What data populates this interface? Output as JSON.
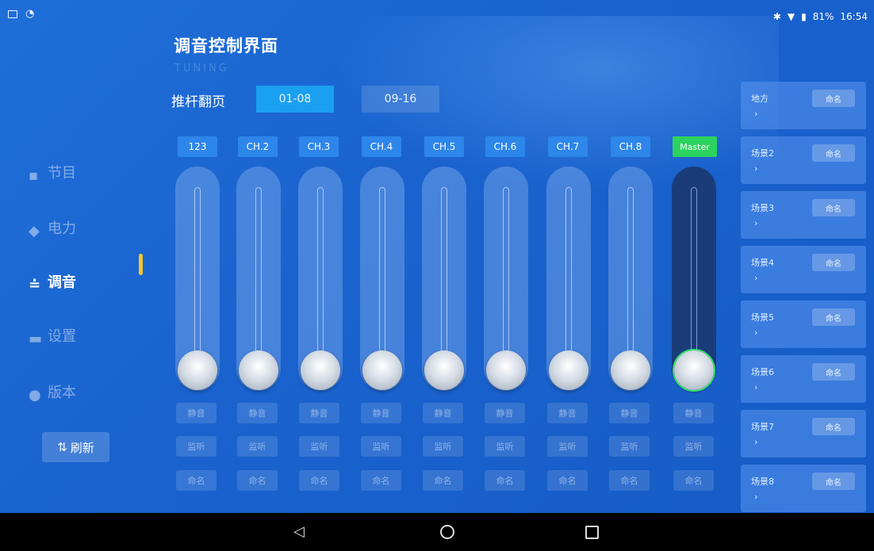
{
  "status_bar": {
    "battery_text": "81%",
    "time": "16:54"
  },
  "header": {
    "title": "调音控制界面",
    "ghost_text": "TUNING"
  },
  "pager": {
    "label": "推杆翻页",
    "tabs": [
      "01-08",
      "09-16"
    ],
    "active_index": 0
  },
  "sidebar": {
    "items": [
      {
        "label": "节目",
        "icon": "program-icon"
      },
      {
        "label": "电力",
        "icon": "power-icon"
      },
      {
        "label": "调音",
        "icon": "sliders-icon"
      },
      {
        "label": "设置",
        "icon": "settings-icon"
      },
      {
        "label": "版本",
        "icon": "version-icon"
      }
    ],
    "active_index": 2,
    "refresh_label": "刷新"
  },
  "channels": [
    {
      "label": "123",
      "level": 0
    },
    {
      "label": "CH.2",
      "level": 0
    },
    {
      "label": "CH.3",
      "level": 0
    },
    {
      "label": "CH.4",
      "level": 0
    },
    {
      "label": "CH.5",
      "level": 0
    },
    {
      "label": "CH.6",
      "level": 0
    },
    {
      "label": "CH.7",
      "level": 0
    },
    {
      "label": "CH.8",
      "level": 0
    },
    {
      "label": "Master",
      "level": 0
    }
  ],
  "channel_buttons": {
    "mute": "静音",
    "listen": "监听",
    "rename": "命名"
  },
  "scenes": [
    {
      "name": "地方",
      "button": "命名"
    },
    {
      "name": "场景2",
      "button": "命名"
    },
    {
      "name": "场景3",
      "button": "命名"
    },
    {
      "name": "场景4",
      "button": "命名"
    },
    {
      "name": "场景5",
      "button": "命名"
    },
    {
      "name": "场景6",
      "button": "命名"
    },
    {
      "name": "场景7",
      "button": "命名"
    },
    {
      "name": "场景8",
      "button": "命名"
    }
  ],
  "scene_arrow": "›",
  "colors": {
    "background": "#1a63cf",
    "active_tab": "#1aa0f0",
    "master": "#2cd35f",
    "indicator": "#f4c62a"
  }
}
